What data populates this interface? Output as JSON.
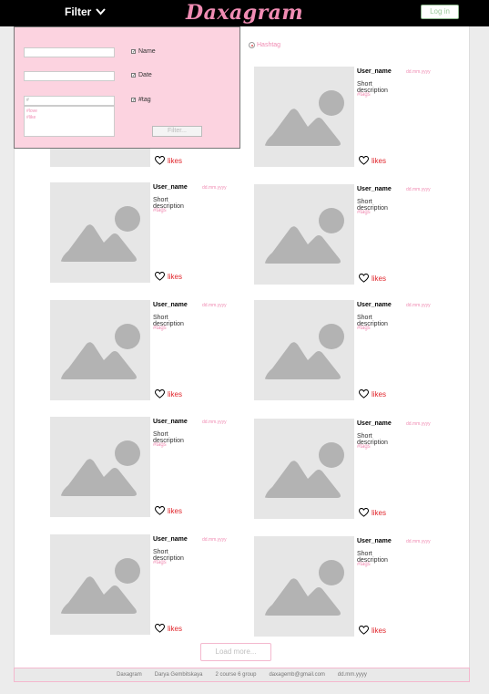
{
  "header": {
    "filter_label": "Filter",
    "logo": "Daxagram",
    "login_label": "Log in"
  },
  "filter_panel": {
    "tag_input_value": "#",
    "tag_list": [
      "#love",
      "#like"
    ],
    "check_name": "Name",
    "check_date": "Date",
    "check_tag": "#tag",
    "button_label": "Filter..."
  },
  "hashtag_radio_label": "Hashtag",
  "posts": [
    {
      "user": "User_name",
      "date": "dd.mm.yyyy",
      "desc": "Short description",
      "tags": "#tags",
      "likes": "likes"
    },
    {
      "user": "User_name",
      "date": "dd.mm.yyyy",
      "desc": "Short description",
      "tags": "#tags",
      "likes": "likes"
    },
    {
      "user": "User_name",
      "date": "dd.mm.yyyy",
      "desc": "Short description",
      "tags": "#tags",
      "likes": "likes"
    },
    {
      "user": "User_name",
      "date": "dd.mm.yyyy",
      "desc": "Short description",
      "tags": "#tags",
      "likes": "likes"
    },
    {
      "user": "User_name",
      "date": "dd.mm.yyyy",
      "desc": "Short description",
      "tags": "#tags",
      "likes": "likes"
    },
    {
      "user": "User_name",
      "date": "dd.mm.yyyy",
      "desc": "Short description",
      "tags": "#tags",
      "likes": "likes"
    },
    {
      "user": "User_name",
      "date": "dd.mm.yyyy",
      "desc": "Short description",
      "tags": "#tags",
      "likes": "likes"
    },
    {
      "user": "User_name",
      "date": "dd.mm.yyyy",
      "desc": "Short description",
      "tags": "#tags",
      "likes": "likes"
    },
    {
      "user": "User_name",
      "date": "dd.mm.yyyy",
      "desc": "Short description",
      "tags": "#tags",
      "likes": "likes"
    },
    {
      "user": "User_name",
      "date": "dd.mm.yyyy",
      "desc": "Short description",
      "tags": "#tags",
      "likes": "likes"
    }
  ],
  "load_more_label": "Load more...",
  "footer": {
    "app": "Daxagram",
    "author": "Darya Gembitskaya",
    "group": "2 course 6 group",
    "email": "daxagemb@gmail.com",
    "date": "dd.mm.yyyy"
  }
}
